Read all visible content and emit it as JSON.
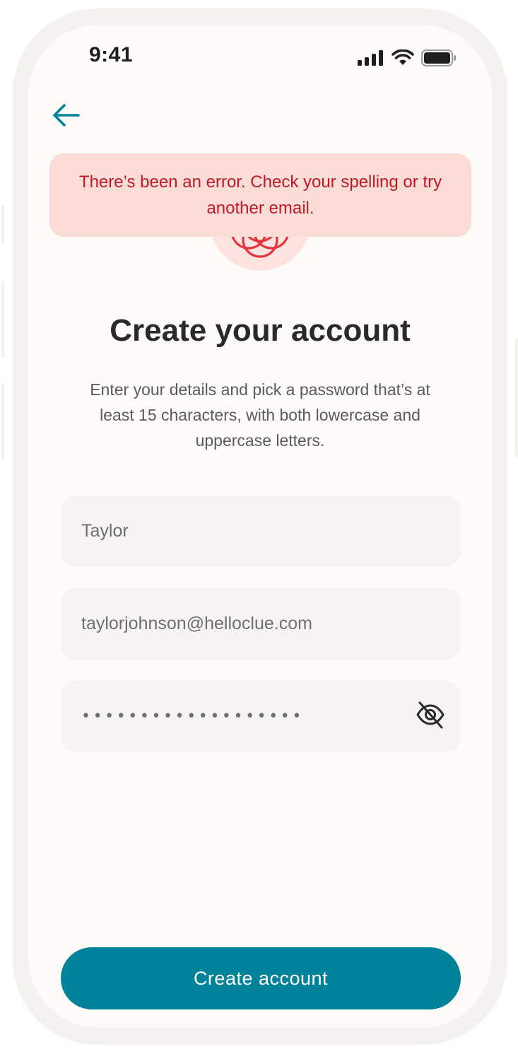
{
  "status_bar": {
    "time": "9:41",
    "signal_icon": "cellular-signal-icon",
    "wifi_icon": "wifi-icon",
    "battery_icon": "battery-icon"
  },
  "nav": {
    "back_icon": "arrow-left-icon"
  },
  "error_banner": {
    "message": "There’s been an error. Check your spelling or try another email."
  },
  "logo": {
    "icon": "clue-flower-logo-icon"
  },
  "page": {
    "title": "Create your account",
    "subtitle": "Enter your details and pick a password that’s at least 15 characters, with both lowercase and uppercase letters."
  },
  "form": {
    "name_value": "Taylor",
    "email_value": "taylorjohnson@helloclue.com",
    "password_mask": "•••••••••••••••••••",
    "password_toggle_icon": "eye-slash-icon"
  },
  "actions": {
    "submit_label": "Create account"
  },
  "colors": {
    "accent": "#00829b",
    "error_bg": "#fcdcd7",
    "error_text": "#c21a27",
    "logo_red": "#e8333a",
    "background": "#fcfbf8",
    "field_bg": "#f5f4f2"
  }
}
